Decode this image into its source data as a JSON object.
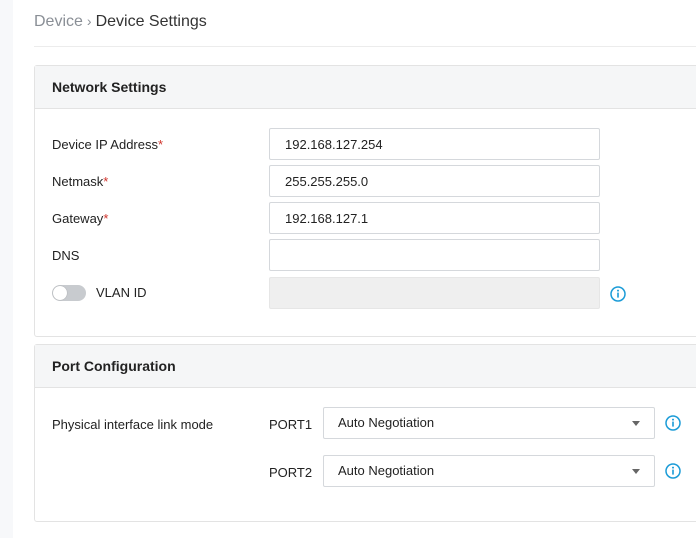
{
  "breadcrumb": {
    "parent": "Device",
    "separator": "›",
    "current": "Device Settings"
  },
  "network_settings": {
    "title": "Network Settings",
    "required_mark": "*",
    "fields": [
      {
        "label": "Device IP Address",
        "required": true,
        "value": "192.168.127.254"
      },
      {
        "label": "Netmask",
        "required": true,
        "value": "255.255.255.0"
      },
      {
        "label": "Gateway",
        "required": true,
        "value": "192.168.127.1"
      },
      {
        "label": "DNS",
        "required": false,
        "value": ""
      }
    ],
    "vlan": {
      "label": "VLAN ID",
      "enabled": false,
      "value": "",
      "icon": "info-icon"
    }
  },
  "port_configuration": {
    "title": "Port Configuration",
    "row_label": "Physical interface link mode",
    "ports": [
      {
        "name": "PORT1",
        "mode": "Auto Negotiation"
      },
      {
        "name": "PORT2",
        "mode": "Auto Negotiation"
      }
    ]
  },
  "colors": {
    "accent": "#1a9bd7",
    "required": "#d0342c",
    "header_bg": "#f5f6f7",
    "toggle_off": "#c8cbcf"
  }
}
